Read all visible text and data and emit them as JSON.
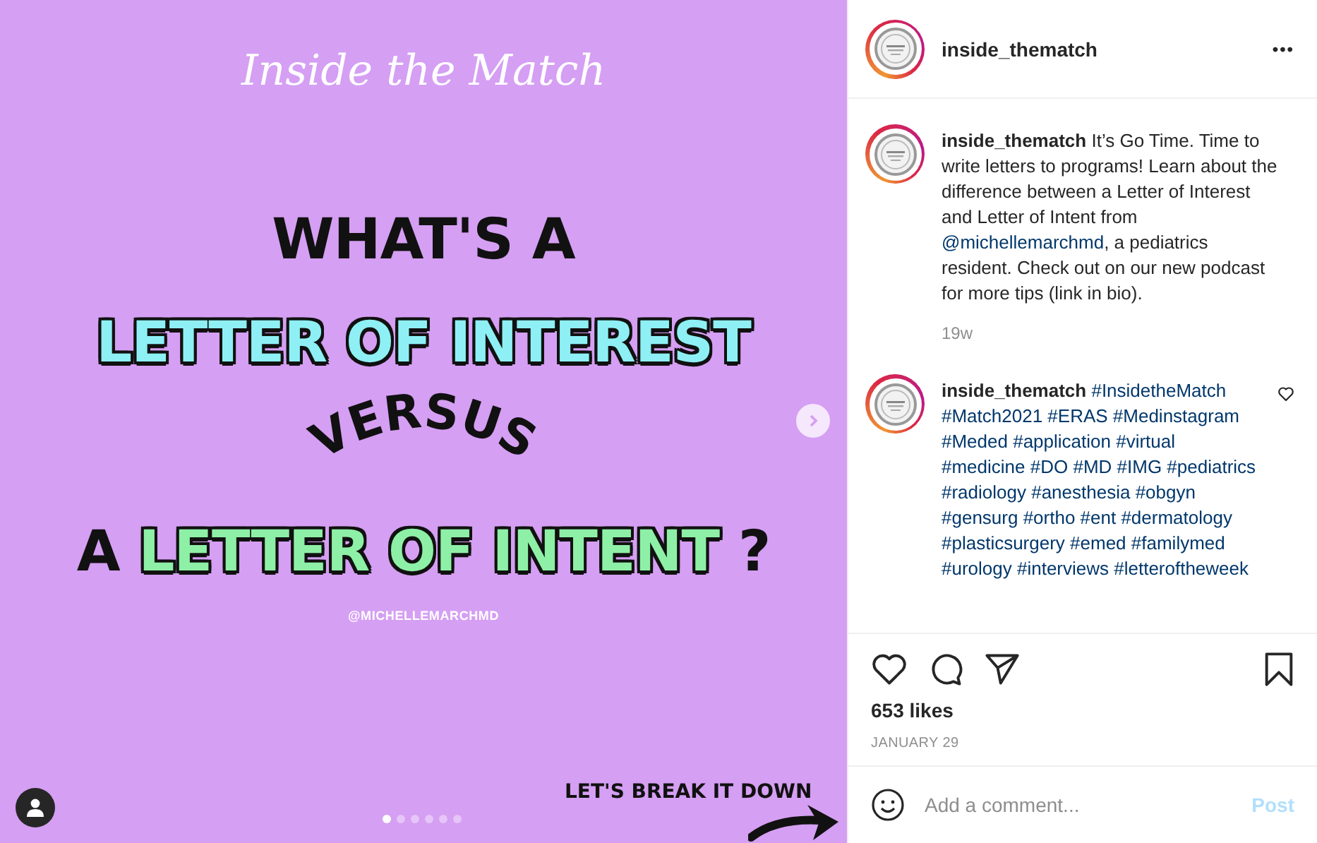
{
  "slide": {
    "title": "Inside the Match",
    "heading_1": "WHAT'S A",
    "heading_2": {
      "text": "LETTER OF INTEREST",
      "color": "#8ef0f4"
    },
    "arched_word": "VERSUS",
    "heading_3": [
      {
        "kind": "plain",
        "text": "A "
      },
      {
        "kind": "highlight",
        "text": "LETTER OF INTENT",
        "color": "#8ef0a6"
      },
      {
        "kind": "plain",
        "text": " ?"
      }
    ],
    "credit": "@MICHELLEMARCHMD",
    "footer": "LET'S BREAK IT DOWN",
    "dots": [
      {
        "selected": true
      },
      {
        "selected": false
      },
      {
        "selected": false
      },
      {
        "selected": false
      },
      {
        "selected": false
      },
      {
        "selected": false
      }
    ]
  },
  "header": {
    "username": "inside_thematch",
    "more": "•••"
  },
  "comments": [
    {
      "username": "inside_thematch",
      "parts": [
        {
          "kind": "text",
          "text": "It’s Go Time. Time to write letters to programs! Learn about the difference between a Letter of Interest and Letter of Intent from "
        },
        {
          "kind": "mention",
          "text": "@michellemarchmd"
        },
        {
          "kind": "text",
          "text": ", a pediatrics resident. Check out on our new podcast for more tips (link in bio)."
        }
      ],
      "time": "19w",
      "likeable": false
    },
    {
      "username": "inside_thematch",
      "parts": [
        {
          "kind": "hashtags",
          "text": "#InsidetheMatch #Match2021 #ERAS #Medinstagram #Meded #application #virtual #medicine #DO #MD #IMG #pediatrics #radiology #anesthesia #obgyn #gensurg #ortho #ent #dermatology #plasticsurgery #emed #familymed #urology #interviews #letteroftheweek"
        }
      ],
      "likeable": true
    }
  ],
  "likes": "653 likes",
  "date": "JANUARY 29",
  "comment_box": {
    "placeholder": "Add a comment...",
    "post_label": "Post",
    "disabled": true
  }
}
